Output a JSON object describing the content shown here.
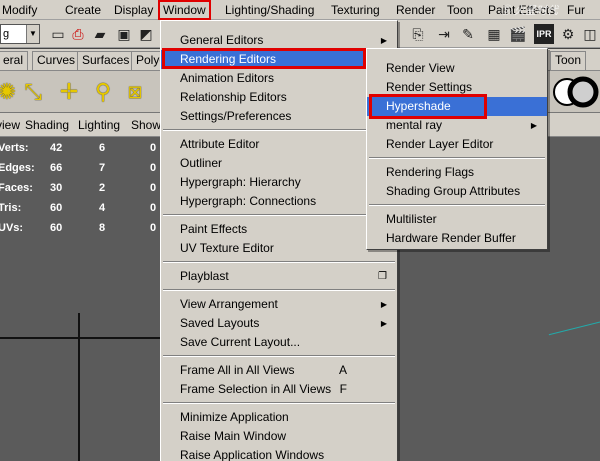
{
  "menubar": {
    "items": [
      "Modify",
      "Create",
      "Display",
      "Window",
      "Lighting/Shading",
      "Texturing",
      "Render",
      "Toon",
      "Paint Effects",
      "Fur"
    ],
    "active": "Window"
  },
  "toolbar": {
    "mode_value": "g"
  },
  "shelf": {
    "tabs": [
      "eral",
      "Curves",
      "Surfaces",
      "Polyg",
      "Toon"
    ]
  },
  "viewport": {
    "menu": [
      "view",
      "Shading",
      "Lighting",
      "Show"
    ],
    "hud": [
      {
        "label": "Verts:",
        "a": "42",
        "b": "6",
        "c": "0"
      },
      {
        "label": "Edges:",
        "a": "66",
        "b": "7",
        "c": "0"
      },
      {
        "label": "Faces:",
        "a": "30",
        "b": "2",
        "c": "0"
      },
      {
        "label": "Tris:",
        "a": "60",
        "b": "4",
        "c": "0"
      },
      {
        "label": "UVs:",
        "a": "60",
        "b": "8",
        "c": "0"
      }
    ]
  },
  "window_menu": {
    "items": [
      "General Editors",
      "Rendering Editors",
      "Animation Editors",
      "Relationship Editors",
      "Settings/Preferences",
      "Attribute Editor",
      "Outliner",
      "Hypergraph: Hierarchy",
      "Hypergraph: Connections",
      "Paint Effects",
      "UV Texture Editor",
      "Playblast",
      "View Arrangement",
      "Saved Layouts",
      "Save Current Layout...",
      "Frame All in All Views",
      "Frame Selection in All Views",
      "Minimize Application",
      "Raise Main Window",
      "Raise Application Windows"
    ],
    "shortcuts": {
      "frame_all": "A",
      "frame_selection": "F"
    }
  },
  "rendering_menu": {
    "items": [
      "Render View",
      "Render Settings",
      "Hypershade",
      "mental ray",
      "Render Layer Editor",
      "Rendering Flags",
      "Shading Group Attributes",
      "Multilister",
      "Hardware Render Buffer"
    ]
  },
  "colors": {
    "highlight": "#3a70d6",
    "callout": "#e00000",
    "menu_bg": "#d4d0c8"
  },
  "watermark": "Ⓢ 火星时代"
}
